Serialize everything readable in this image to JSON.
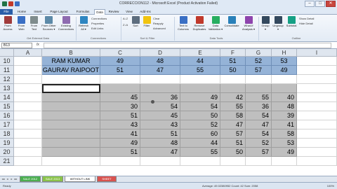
{
  "window": {
    "title": "CORRECCION112 - Microsoft Excel (Product Activation Failed)",
    "qat_colors": [
      "#217346",
      "#c0392b",
      "#3a6fc4"
    ],
    "controls": [
      "–",
      "□",
      "✕"
    ]
  },
  "ribbon_tabs": [
    "File",
    "Home",
    "Insert",
    "Page Layout",
    "Formulas",
    "Data",
    "Review",
    "View",
    "Add-Ins"
  ],
  "active_tab": "Data",
  "ribbon": {
    "get_external": [
      {
        "label": "From\nAccess",
        "icon": "access-icon",
        "color": "#a03b3b"
      },
      {
        "label": "From\nWeb",
        "icon": "web-icon",
        "color": "#3a6fc4"
      },
      {
        "label": "From\nText",
        "icon": "text-file-icon",
        "color": "#7f8c8d"
      },
      {
        "label": "From Other\nSources ▾",
        "icon": "other-sources-icon",
        "color": "#5d8aa8"
      },
      {
        "label": "Existing\nConnections",
        "icon": "connections-icon",
        "color": "#8e6bb0"
      }
    ],
    "get_external_group": "Get External Data",
    "refresh_label": "Refresh\nAll ▾",
    "connections_small": [
      "Connections",
      "Properties",
      "Edit Links"
    ],
    "connections_group": "Connections",
    "sort_small": [
      "A↓Z",
      "Z↓A"
    ],
    "sort_label": "Sort",
    "filter_label": "Filter",
    "filter_small": [
      "Clear",
      "Reapply",
      "Advanced"
    ],
    "sort_group": "Sort & Filter",
    "tools": [
      {
        "label": "Text to\nColumns",
        "icon": "text-to-columns-icon",
        "color": "#3a6fc4"
      },
      {
        "label": "Remove\nDuplicates",
        "icon": "remove-duplicates-icon",
        "color": "#c0392b"
      },
      {
        "label": "Data\nValidation ▾",
        "icon": "validation-icon",
        "color": "#27ae60"
      },
      {
        "label": "Consolidate",
        "icon": "consolidate-icon",
        "color": "#2980b9"
      },
      {
        "label": "What-If\nAnalysis ▾",
        "icon": "what-if-icon",
        "color": "#8e44ad"
      }
    ],
    "tools_group": "Data Tools",
    "outline": [
      {
        "label": "Group\n▾",
        "icon": "group-icon",
        "color": "#34495e"
      },
      {
        "label": "Ungroup\n▾",
        "icon": "ungroup-icon",
        "color": "#34495e"
      },
      {
        "label": "Subtotal",
        "icon": "subtotal-icon",
        "color": "#16a085"
      }
    ],
    "outline_small": [
      "Show Detail",
      "Hide Detail"
    ],
    "outline_group": "Outline"
  },
  "formula_bar": {
    "name_box": "B13",
    "fx": "fx",
    "content": ""
  },
  "columns": [
    "A",
    "B",
    "C",
    "D",
    "E",
    "F",
    "G",
    "H",
    "I"
  ],
  "rows": [
    "10",
    "11",
    "12",
    "13",
    "14",
    "15",
    "16",
    "17",
    "18",
    "19",
    "20",
    "21"
  ],
  "table_rows": [
    {
      "name": "RAM KUMAR",
      "values": [
        "49",
        "48",
        "44",
        "51",
        "52",
        "53"
      ]
    },
    {
      "name": "GAURAV RAIPOOT",
      "values": [
        "51",
        "47",
        "55",
        "50",
        "57",
        "49"
      ]
    }
  ],
  "pasted_block": [
    [
      "45",
      "36",
      "49",
      "42",
      "55",
      "40"
    ],
    [
      "30",
      "54",
      "54",
      "55",
      "36",
      "48"
    ],
    [
      "51",
      "45",
      "50",
      "58",
      "54",
      "39"
    ],
    [
      "43",
      "43",
      "52",
      "47",
      "47",
      "41"
    ],
    [
      "41",
      "51",
      "60",
      "57",
      "54",
      "58"
    ],
    [
      "49",
      "48",
      "44",
      "51",
      "52",
      "53"
    ],
    [
      "51",
      "47",
      "55",
      "50",
      "57",
      "49"
    ]
  ],
  "sheet_nav": [
    "◂◂",
    "◂",
    "▸",
    "▸▸"
  ],
  "sheet_tabs": [
    {
      "label": "SALE 2012",
      "bg": "#4caf50",
      "color": "#ffffff"
    },
    {
      "label": "SALE 2013",
      "bg": "#8bc34a",
      "color": "#ffffff"
    },
    {
      "label": "WITHOUT LINK",
      "bg": "#ffffff",
      "color": "#000000"
    },
    {
      "label": "SHEET",
      "bg": "#d9534f",
      "color": "#ffffff"
    }
  ],
  "status": {
    "ready": "Ready",
    "stats": "Average: 49.02380952    Count: 42    Sum: 2058",
    "zoom": "100%"
  },
  "colors": {
    "blue_fill": "#95b3d7",
    "grey_fill": "#bfbfbf",
    "header_fill": "#dfe6ef"
  }
}
